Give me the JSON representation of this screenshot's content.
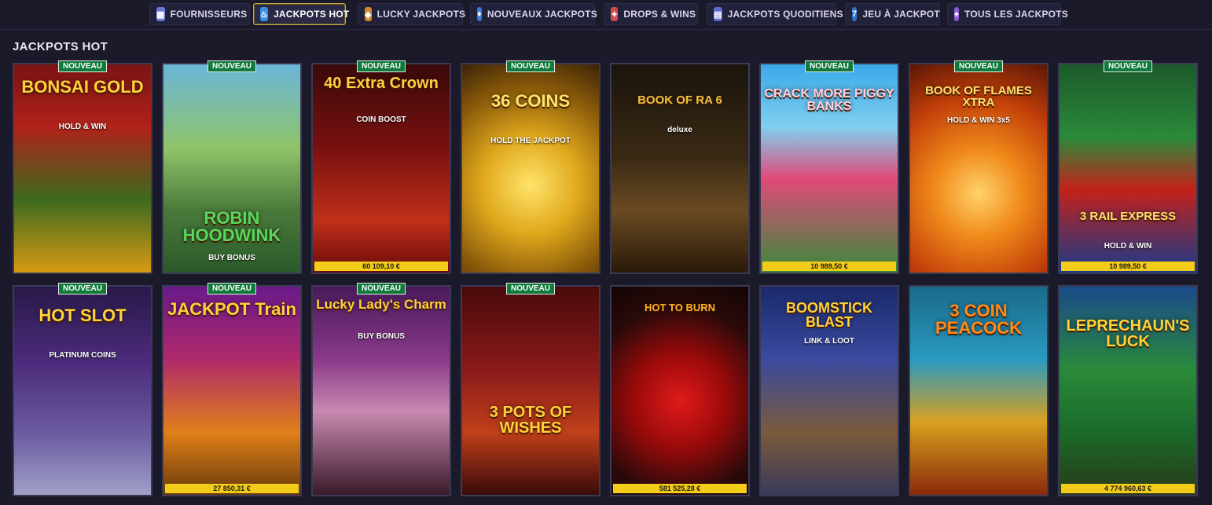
{
  "nav": {
    "tabs": [
      {
        "label": "FOURNISSEURS",
        "icon": "providers-icon",
        "color": "#6a7bd6"
      },
      {
        "label": "JACKPOTS HOT",
        "icon": "flame-icon",
        "color": "#3a8ee0"
      },
      {
        "label": "LUCKY JACKPOTS",
        "icon": "ticket-icon",
        "color": "#d08a2a"
      },
      {
        "label": "NOUVEAUX JACKPOTS",
        "icon": "bottle-icon",
        "color": "#3b7bd8"
      },
      {
        "label": "DROPS & WINS",
        "icon": "gift-icon",
        "color": "#d24a4a"
      },
      {
        "label": "JACKPOTS QUODITIENS",
        "icon": "calendar-icon",
        "color": "#5a6ad0"
      },
      {
        "label": "JEU À JACKPOT",
        "icon": "slot-machine-icon",
        "color": "#2e72c9"
      },
      {
        "label": "TOUS LES JACKPOTS",
        "icon": "cards-icon",
        "color": "#8a5ad0"
      }
    ],
    "active_index": 1
  },
  "section": {
    "title": "JACKPOTS HOT"
  },
  "badge_label": "NOUVEAU",
  "games": [
    {
      "title": "BONSAI GOLD",
      "sub": "HOLD & WIN",
      "new": true,
      "amount": ""
    },
    {
      "title": "ROBIN HOODWINK",
      "sub": "BUY BONUS",
      "new": true,
      "amount": ""
    },
    {
      "title": "40 Extra Crown",
      "sub": "COIN BOOST",
      "new": true,
      "amount": "60 109,10 €"
    },
    {
      "title": "36 COINS",
      "sub": "HOLD THE JACKPOT",
      "new": true,
      "amount": ""
    },
    {
      "title": "BOOK OF RA 6",
      "sub": "deluxe",
      "new": false,
      "amount": ""
    },
    {
      "title": "CRACK MORE PIGGY BANKS",
      "sub": "",
      "new": true,
      "amount": "10 989,50 €"
    },
    {
      "title": "BOOK OF FLAMES XTRA",
      "sub": "HOLD & WIN 3x5",
      "new": true,
      "amount": ""
    },
    {
      "title": "3 RAIL EXPRESS",
      "sub": "HOLD & WIN",
      "new": true,
      "amount": "10 989,50 €"
    },
    {
      "title": "HOT SLOT",
      "sub": "PLATINUM COINS",
      "new": true,
      "amount": ""
    },
    {
      "title": "JACKPOT Train",
      "sub": "",
      "new": true,
      "amount": "27 850,31 €"
    },
    {
      "title": "Lucky Lady's Charm",
      "sub": "BUY BONUS",
      "new": true,
      "amount": ""
    },
    {
      "title": "3 POTS OF WISHES",
      "sub": "",
      "new": true,
      "amount": ""
    },
    {
      "title": "HOT TO BURN",
      "sub": "",
      "new": false,
      "amount": "581 525,28 €"
    },
    {
      "title": "BOOMSTICK BLAST",
      "sub": "LINK & LOOT",
      "new": false,
      "amount": ""
    },
    {
      "title": "3 COIN PEACOCK",
      "sub": "",
      "new": false,
      "amount": ""
    },
    {
      "title": "LEPRECHAUN'S LUCK",
      "sub": "",
      "new": false,
      "amount": "4 774 960,63 €"
    }
  ]
}
